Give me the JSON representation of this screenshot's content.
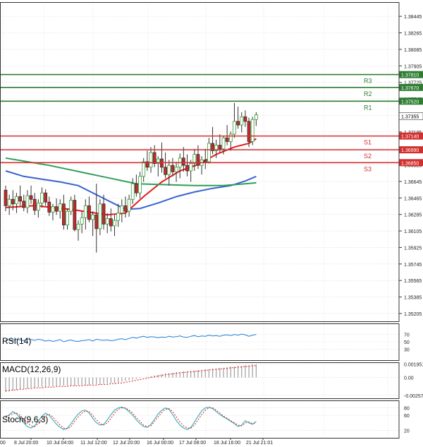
{
  "colors": {
    "up": "#3a9a32",
    "down": "#c62828",
    "ma_fast": "#e21b1b",
    "ma_mid": "#3a62d1",
    "ma_slow": "#2f9e5a",
    "resistance": "#2e7d32",
    "support": "#d32f2f",
    "grid": "#c9c9c9",
    "rsi": "#1e7fd6",
    "macd_bar": "#9e9e9e",
    "macd_signal": "#e21b1b",
    "stoch_k": "#19a7b0",
    "stoch_d": "#e21b1b"
  },
  "chart_data": [
    {
      "type": "candlestick",
      "ylim": [
        1.3512,
        1.386
      ],
      "yticks": [
        "1.38445",
        "1.38265",
        "1.38085",
        "1.37905",
        "1.37725",
        "1.37545",
        "1.37365",
        "1.37185",
        "1.37005",
        "1.36825",
        "1.36645",
        "1.36465",
        "1.36285",
        "1.36105",
        "1.35925",
        "1.35745",
        "1.35565",
        "1.35385",
        "1.35205"
      ],
      "xlabels": [
        "8 Jul 20:00",
        "10 Jul 04:00",
        "11 Jul 12:00",
        "12 Jul 20:00",
        "16 Jul 00:00",
        "17 Jul 08:00",
        "18 Jul 16:00",
        "21 Jul 21:01"
      ],
      "xlabel_leading": "00",
      "candles": [
        [
          1.3655,
          1.366,
          1.3632,
          1.3638
        ],
        [
          1.3638,
          1.365,
          1.3628,
          1.3645
        ],
        [
          1.3645,
          1.3655,
          1.3633,
          1.364
        ],
        [
          1.364,
          1.3652,
          1.363,
          1.3648
        ],
        [
          1.3648,
          1.366,
          1.3638,
          1.3643
        ],
        [
          1.3643,
          1.365,
          1.3632,
          1.3636
        ],
        [
          1.3636,
          1.3655,
          1.363,
          1.3649
        ],
        [
          1.3649,
          1.366,
          1.364,
          1.3645
        ],
        [
          1.3645,
          1.3652,
          1.3628,
          1.3633
        ],
        [
          1.3633,
          1.3645,
          1.3625,
          1.3641
        ],
        [
          1.3641,
          1.3658,
          1.3636,
          1.3652
        ],
        [
          1.3652,
          1.3656,
          1.3638,
          1.3642
        ],
        [
          1.3642,
          1.3648,
          1.3627,
          1.3631
        ],
        [
          1.3631,
          1.364,
          1.3622,
          1.3637
        ],
        [
          1.3637,
          1.3646,
          1.3628,
          1.3632
        ],
        [
          1.3632,
          1.3645,
          1.3624,
          1.364
        ],
        [
          1.364,
          1.365,
          1.3612,
          1.3617
        ],
        [
          1.3617,
          1.3635,
          1.3612,
          1.3632
        ],
        [
          1.3632,
          1.3648,
          1.3628,
          1.3644
        ],
        [
          1.3644,
          1.365,
          1.361,
          1.3612
        ],
        [
          1.3612,
          1.3622,
          1.36,
          1.3618
        ],
        [
          1.3618,
          1.3632,
          1.3608,
          1.3625
        ],
        [
          1.3625,
          1.3645,
          1.3612,
          1.3638
        ],
        [
          1.3638,
          1.3648,
          1.362,
          1.3623
        ],
        [
          1.3623,
          1.3632,
          1.3605,
          1.3628
        ],
        [
          1.3628,
          1.3662,
          1.3587,
          1.3613
        ],
        [
          1.3613,
          1.3645,
          1.3606,
          1.364
        ],
        [
          1.364,
          1.365,
          1.3612,
          1.3618
        ],
        [
          1.3618,
          1.363,
          1.3608,
          1.3624
        ],
        [
          1.3624,
          1.3635,
          1.361,
          1.3616
        ],
        [
          1.3616,
          1.3628,
          1.3605,
          1.3622
        ],
        [
          1.3622,
          1.364,
          1.3615,
          1.363
        ],
        [
          1.363,
          1.3645,
          1.362,
          1.3638
        ],
        [
          1.3638,
          1.3648,
          1.3625,
          1.3632
        ],
        [
          1.3632,
          1.365,
          1.3626,
          1.3645
        ],
        [
          1.3645,
          1.3668,
          1.364,
          1.3662
        ],
        [
          1.3662,
          1.3672,
          1.3648,
          1.3652
        ],
        [
          1.3652,
          1.3675,
          1.3646,
          1.367
        ],
        [
          1.367,
          1.369,
          1.3664,
          1.3686
        ],
        [
          1.3686,
          1.3698,
          1.3676,
          1.368
        ],
        [
          1.368,
          1.3702,
          1.3674,
          1.3696
        ],
        [
          1.3696,
          1.3704,
          1.368,
          1.3684
        ],
        [
          1.3684,
          1.3692,
          1.367,
          1.3689
        ],
        [
          1.3689,
          1.3707,
          1.3674,
          1.368
        ],
        [
          1.368,
          1.3696,
          1.3668,
          1.3672
        ],
        [
          1.3672,
          1.3688,
          1.366,
          1.3682
        ],
        [
          1.3682,
          1.369,
          1.367,
          1.3675
        ],
        [
          1.3675,
          1.3686,
          1.3664,
          1.368
        ],
        [
          1.368,
          1.3695,
          1.3668,
          1.369
        ],
        [
          1.369,
          1.3702,
          1.3675,
          1.3682
        ],
        [
          1.3682,
          1.3694,
          1.367,
          1.3676
        ],
        [
          1.3676,
          1.3688,
          1.3664,
          1.3684
        ],
        [
          1.3684,
          1.37,
          1.3676,
          1.3694
        ],
        [
          1.3694,
          1.3704,
          1.3678,
          1.3682
        ],
        [
          1.3682,
          1.3692,
          1.3672,
          1.3688
        ],
        [
          1.3688,
          1.37,
          1.3678,
          1.3686
        ],
        [
          1.3686,
          1.3712,
          1.3684,
          1.3706
        ],
        [
          1.3706,
          1.3724,
          1.3694,
          1.3698
        ],
        [
          1.3698,
          1.371,
          1.369,
          1.3704
        ],
        [
          1.3704,
          1.3716,
          1.3696,
          1.37
        ],
        [
          1.37,
          1.3714,
          1.3694,
          1.3712
        ],
        [
          1.3712,
          1.3726,
          1.3704,
          1.3708
        ],
        [
          1.3708,
          1.3719,
          1.3698,
          1.3716
        ],
        [
          1.3716,
          1.375,
          1.3712,
          1.373
        ],
        [
          1.373,
          1.3746,
          1.3722,
          1.3726
        ],
        [
          1.3726,
          1.374,
          1.3718,
          1.3735
        ],
        [
          1.3735,
          1.3742,
          1.3724,
          1.373
        ],
        [
          1.373,
          1.3734,
          1.3702,
          1.3708
        ],
        [
          1.3708,
          1.3735,
          1.3704,
          1.3732
        ],
        [
          1.3732,
          1.374,
          1.3725,
          1.3737
        ]
      ],
      "moving_averages": [
        {
          "role": "fast",
          "points": [
            [
              0,
              1.3636
            ],
            [
              8,
              1.3638
            ],
            [
              18,
              1.3634
            ],
            [
              28,
              1.3628
            ],
            [
              33,
              1.363
            ],
            [
              38,
              1.3648
            ],
            [
              43,
              1.3664
            ],
            [
              48,
              1.3676
            ],
            [
              53,
              1.3683
            ],
            [
              58,
              1.3694
            ],
            [
              63,
              1.3702
            ],
            [
              67,
              1.3706
            ],
            [
              69,
              1.3711
            ]
          ]
        },
        {
          "role": "mid",
          "points": [
            [
              0,
              1.3676
            ],
            [
              5,
              1.367
            ],
            [
              10,
              1.3667
            ],
            [
              15,
              1.3664
            ],
            [
              20,
              1.366
            ],
            [
              26,
              1.3648
            ],
            [
              30,
              1.364
            ],
            [
              33,
              1.3634
            ],
            [
              37,
              1.3635
            ],
            [
              42,
              1.3641
            ],
            [
              47,
              1.3648
            ],
            [
              52,
              1.3653
            ],
            [
              57,
              1.3657
            ],
            [
              62,
              1.366
            ],
            [
              66,
              1.3665
            ],
            [
              69,
              1.367
            ]
          ]
        },
        {
          "role": "slow",
          "points": [
            [
              0,
              1.369
            ],
            [
              6,
              1.3686
            ],
            [
              12,
              1.3682
            ],
            [
              18,
              1.3677
            ],
            [
              24,
              1.3672
            ],
            [
              30,
              1.3667
            ],
            [
              36,
              1.3662
            ],
            [
              44,
              1.3661
            ],
            [
              52,
              1.366
            ],
            [
              60,
              1.366
            ],
            [
              66,
              1.3662
            ],
            [
              69,
              1.3663
            ]
          ]
        }
      ],
      "levels": [
        {
          "name": "R3",
          "value": "1.37810",
          "kind": "resistance"
        },
        {
          "name": "R2",
          "value": "1.37670",
          "kind": "resistance"
        },
        {
          "name": "R1",
          "value": "1.37520",
          "kind": "resistance"
        },
        {
          "name": "S1",
          "value": "1.37140",
          "kind": "support"
        },
        {
          "name": "S2",
          "value": "1.36990",
          "kind": "support"
        },
        {
          "name": "S3",
          "value": "1.36850",
          "kind": "support"
        }
      ],
      "last_price": "1.37355"
    },
    {
      "type": "line",
      "title": "RSI(14)",
      "ylim": [
        0,
        100
      ],
      "yticks": [
        "70",
        "50",
        "30"
      ],
      "values": [
        55,
        56,
        54,
        57,
        55,
        53,
        58,
        56,
        54,
        57,
        55,
        52,
        54,
        51,
        53,
        56,
        50,
        53,
        55,
        52,
        51,
        53,
        54,
        56,
        52,
        57,
        55,
        54,
        55,
        53,
        54,
        57,
        58,
        56,
        59,
        62,
        60,
        63,
        65,
        62,
        64,
        63,
        61,
        63,
        62,
        65,
        63,
        64,
        66,
        63,
        62,
        65,
        67,
        64,
        66,
        65,
        68,
        66,
        67,
        65,
        68,
        69,
        67,
        70,
        68,
        71,
        69,
        65,
        68,
        70
      ]
    },
    {
      "type": "bar",
      "title": "MACD(12,26,9)",
      "ylim": [
        -0.003,
        0.0022
      ],
      "yticks": [
        "0.001951",
        "0.00",
        "-0.002572"
      ],
      "values": [
        -0.0021,
        -0.002,
        -0.0019,
        -0.0018,
        -0.0017,
        -0.0016,
        -0.0016,
        -0.0015,
        -0.0015,
        -0.0014,
        -0.0014,
        -0.0014,
        -0.0013,
        -0.0013,
        -0.0013,
        -0.0012,
        -0.0012,
        -0.0012,
        -0.0012,
        -0.0012,
        -0.0011,
        -0.0011,
        -0.0011,
        -0.0011,
        -0.001,
        -0.001,
        -0.001,
        -0.0009,
        -0.0009,
        -0.0008,
        -0.0008,
        -0.0007,
        -0.0006,
        -0.0005,
        -0.0004,
        -0.0003,
        -0.0002,
        -0.0001,
        0.0,
        0.0001,
        0.0002,
        0.0003,
        0.0004,
        0.0005,
        0.0006,
        0.0006,
        0.0007,
        0.0008,
        0.0008,
        0.0009,
        0.0009,
        0.001,
        0.001,
        0.0011,
        0.0011,
        0.0012,
        0.0012,
        0.0013,
        0.0013,
        0.0014,
        0.0014,
        0.0015,
        0.0016,
        0.0016,
        0.0017,
        0.0017,
        0.0018,
        0.0018,
        0.0019,
        0.0019
      ],
      "signal": [
        -0.0019,
        -0.0019,
        -0.0018,
        -0.0018,
        -0.0017,
        -0.0017,
        -0.0016,
        -0.0016,
        -0.0015,
        -0.0015,
        -0.0015,
        -0.0014,
        -0.0014,
        -0.0014,
        -0.0013,
        -0.0013,
        -0.0013,
        -0.0013,
        -0.0012,
        -0.0012,
        -0.0012,
        -0.0012,
        -0.0011,
        -0.0011,
        -0.0011,
        -0.0011,
        -0.001,
        -0.001,
        -0.001,
        -0.0009,
        -0.0009,
        -0.0008,
        -0.0008,
        -0.0007,
        -0.0006,
        -0.0005,
        -0.0004,
        -0.0003,
        -0.0002,
        -0.0001,
        0.0,
        0.0001,
        0.0002,
        0.0003,
        0.0004,
        0.0005,
        0.0005,
        0.0006,
        0.0007,
        0.0007,
        0.0008,
        0.0008,
        0.0009,
        0.0009,
        0.001,
        0.001,
        0.0011,
        0.0011,
        0.0012,
        0.0012,
        0.0013,
        0.0013,
        0.0014,
        0.0014,
        0.0015,
        0.0015,
        0.0016,
        0.0016,
        0.0017,
        0.0017
      ]
    },
    {
      "type": "line",
      "title": "Stoch(9,6,3)",
      "ylim": [
        0,
        100
      ],
      "yticks": [
        "80",
        "60",
        "20"
      ],
      "k": [
        55,
        62,
        70,
        64,
        52,
        40,
        30,
        26,
        32,
        45,
        58,
        66,
        60,
        48,
        36,
        28,
        22,
        26,
        38,
        52,
        64,
        72,
        74,
        66,
        52,
        40,
        34,
        36,
        48,
        62,
        74,
        80,
        82,
        78,
        70,
        60,
        48,
        38,
        30,
        28,
        36,
        50,
        64,
        74,
        80,
        76,
        62,
        46,
        34,
        26,
        22,
        28,
        42,
        58,
        72,
        80,
        82,
        78,
        70,
        62,
        56,
        50,
        44,
        38,
        30,
        34,
        46,
        40,
        36,
        44
      ],
      "d": [
        58,
        60,
        64,
        66,
        60,
        50,
        40,
        32,
        30,
        38,
        50,
        60,
        62,
        56,
        44,
        34,
        26,
        24,
        30,
        44,
        56,
        66,
        72,
        70,
        60,
        48,
        38,
        34,
        40,
        52,
        66,
        76,
        80,
        80,
        74,
        66,
        54,
        44,
        34,
        30,
        32,
        44,
        56,
        68,
        76,
        78,
        70,
        56,
        42,
        32,
        26,
        26,
        34,
        48,
        62,
        74,
        80,
        80,
        74,
        66,
        58,
        52,
        46,
        40,
        34,
        32,
        40,
        42,
        38,
        40
      ]
    }
  ]
}
